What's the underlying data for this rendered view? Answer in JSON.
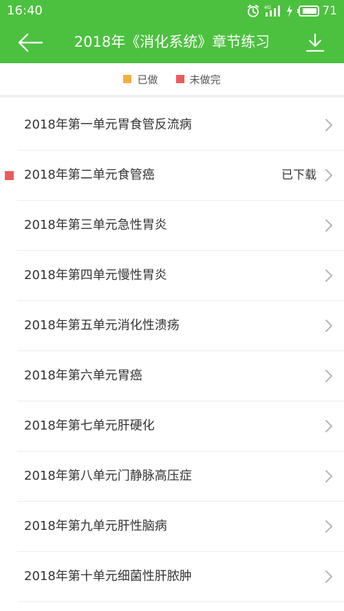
{
  "status_bar": {
    "time": "16:40",
    "network_label": "4G",
    "battery_level": "71",
    "icons": [
      "alarm-icon",
      "signal-icon",
      "charging-icon",
      "battery-icon"
    ]
  },
  "header": {
    "title": "2018年《消化系统》章节练习",
    "back_icon": "back-arrow-icon",
    "download_icon": "download-icon"
  },
  "legend": {
    "items": [
      {
        "label": "已做",
        "color": "#f0b13c"
      },
      {
        "label": "未做完",
        "color": "#ec5b5b"
      }
    ]
  },
  "colors": {
    "header_bg": "#4cc13f",
    "unfinished_marker": "#ec5b5b"
  },
  "chapters": [
    {
      "title": "2018年第一单元胃食管反流病",
      "status": ""
    },
    {
      "title": "2018年第二单元食管癌",
      "status": "已下载"
    },
    {
      "title": "2018年第三单元急性胃炎",
      "status": ""
    },
    {
      "title": "2018年第四单元慢性胃炎",
      "status": ""
    },
    {
      "title": "2018年第五单元消化性溃疡",
      "status": ""
    },
    {
      "title": "2018年第六单元胃癌",
      "status": ""
    },
    {
      "title": "2018年第七单元肝硬化",
      "status": ""
    },
    {
      "title": "2018年第八单元门静脉高压症",
      "status": ""
    },
    {
      "title": "2018年第九单元肝性脑病",
      "status": ""
    },
    {
      "title": "2018年第十单元细菌性肝脓肿",
      "status": ""
    }
  ]
}
